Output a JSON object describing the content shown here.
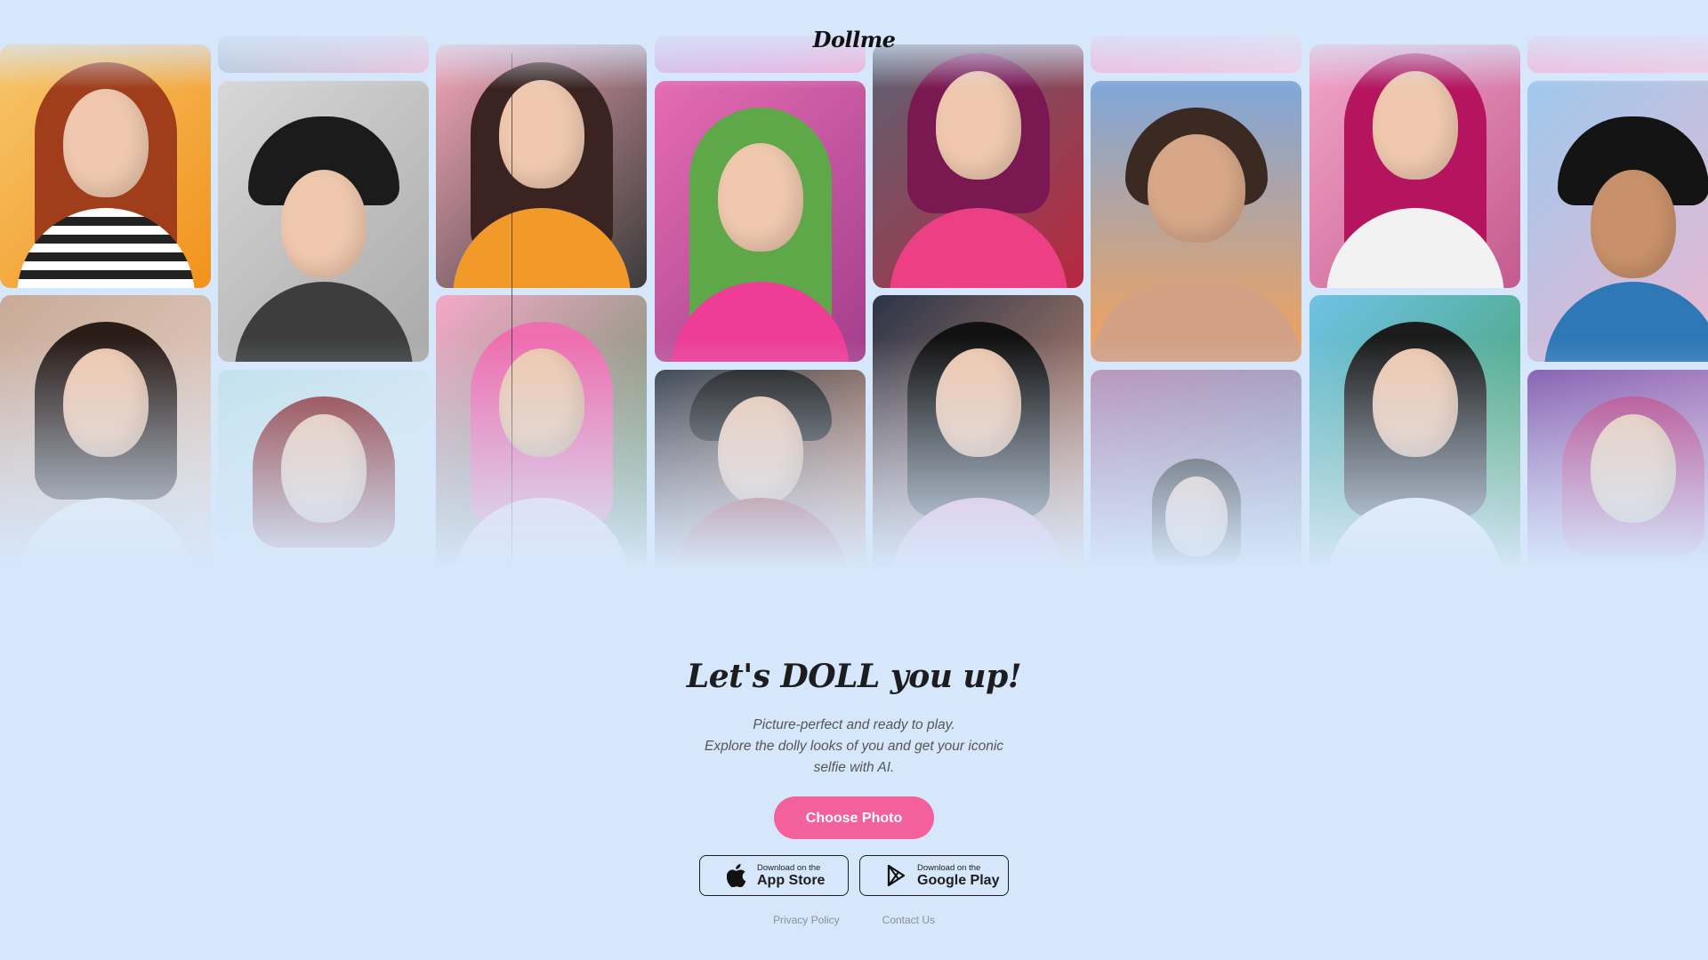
{
  "brand": {
    "logo": "Dollme"
  },
  "hero": {
    "headline": "Let's DOLL you up!",
    "subtitle_lines": [
      "Picture-perfect and ready to play.",
      "Explore the dolly looks of you and get your iconic",
      "selfie with AI."
    ],
    "cta_label": "Choose Photo"
  },
  "stores": {
    "apple": {
      "small": "Download on the",
      "big": "App Store",
      "icon": "apple-icon"
    },
    "google": {
      "small": "Download on the",
      "big": "Google Play",
      "icon": "google-play-icon"
    }
  },
  "footer": {
    "privacy": "Privacy Policy",
    "contact": "Contact Us"
  },
  "colors": {
    "background": "#d6e7fb",
    "accent": "#f3609b",
    "text": "#1d1d1f"
  }
}
